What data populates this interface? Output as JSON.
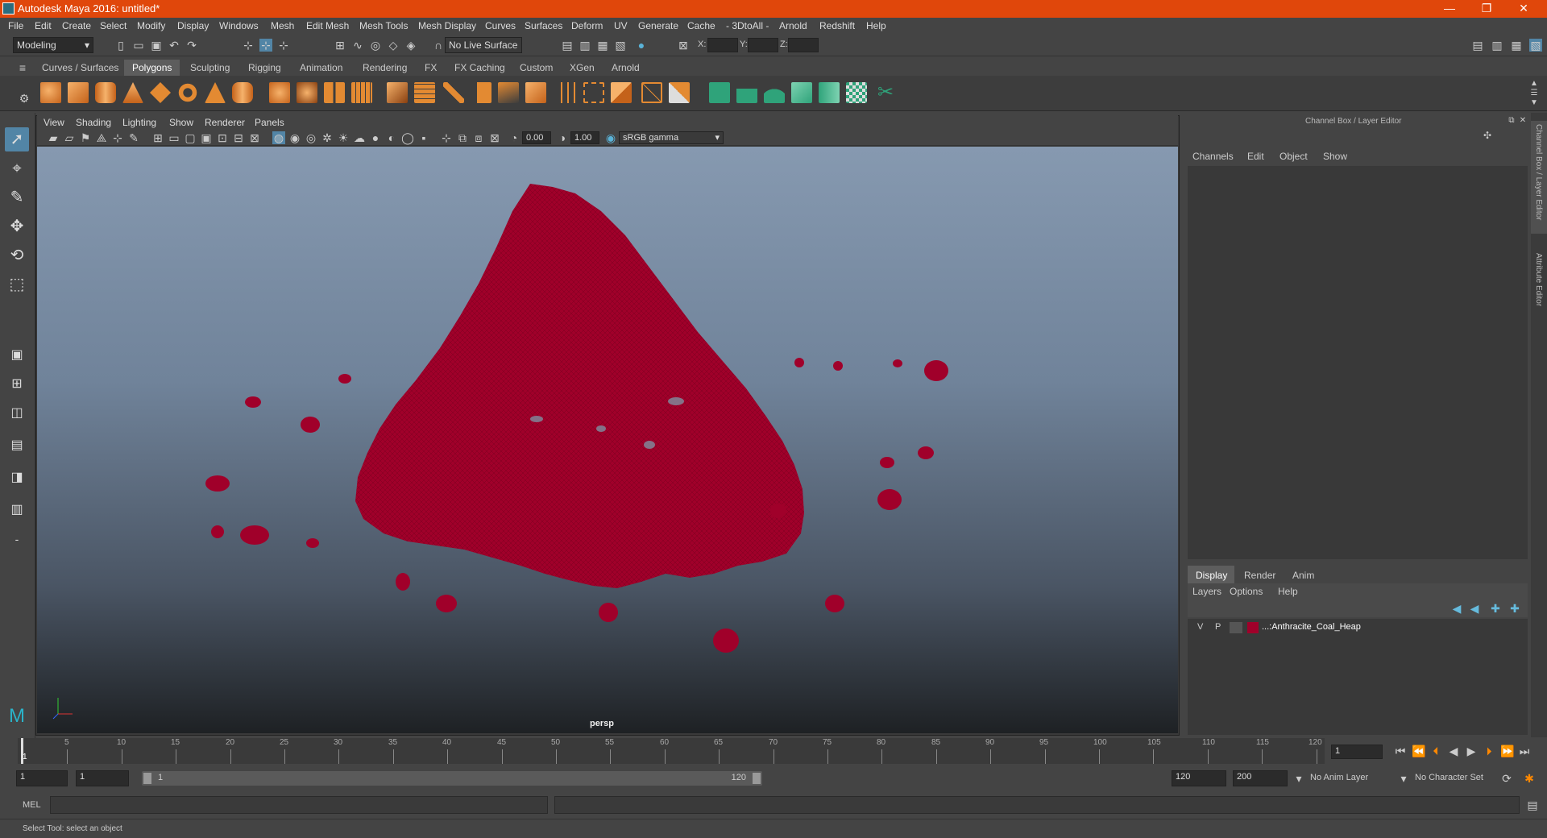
{
  "window": {
    "title": "Autodesk Maya 2016: untitled*",
    "minimize": "—",
    "restore": "❐",
    "close": "✕"
  },
  "menus": [
    "File",
    "Edit",
    "Create",
    "Select",
    "Modify",
    "Display",
    "Windows",
    "Mesh",
    "Edit Mesh",
    "Mesh Tools",
    "Mesh Display",
    "Curves",
    "Surfaces",
    "Deform",
    "UV",
    "Generate",
    "Cache",
    "- 3DtoAll -",
    "Arnold",
    "Redshift",
    "Help"
  ],
  "status": {
    "mode": "Modeling",
    "live_surface": "No Live Surface",
    "x_label": "X:",
    "y_label": "Y:",
    "z_label": "Z:"
  },
  "shelf": {
    "tabs": [
      "Curves / Surfaces",
      "Polygons",
      "Sculpting",
      "Rigging",
      "Animation",
      "Rendering",
      "FX",
      "FX Caching",
      "Custom",
      "XGen",
      "Arnold"
    ],
    "active_tab": "Polygons"
  },
  "viewport": {
    "menus": [
      "View",
      "Shading",
      "Lighting",
      "Show",
      "Renderer",
      "Panels"
    ],
    "exposure": "0.00",
    "gamma": "1.00",
    "color_space": "sRGB gamma",
    "camera_label": "persp",
    "mesh_color": "#a0002a"
  },
  "channel_box": {
    "header": "Channel Box / Layer Editor",
    "menus": [
      "Channels",
      "Edit",
      "Object",
      "Show"
    ]
  },
  "layer_editor": {
    "tabs": [
      "Display",
      "Render",
      "Anim"
    ],
    "active_tab": "Display",
    "menus": [
      "Layers",
      "Options",
      "Help"
    ],
    "layers": [
      {
        "v": "V",
        "p": "P",
        "color": "#a0002a",
        "name": "...:Anthracite_Coal_Heap"
      }
    ]
  },
  "side_tabs": [
    "Channel Box / Layer Editor",
    "Attribute Editor"
  ],
  "timeline": {
    "ticks": [
      "5",
      "10",
      "15",
      "20",
      "25",
      "30",
      "35",
      "40",
      "45",
      "50",
      "55",
      "60",
      "65",
      "70",
      "75",
      "80",
      "85",
      "90",
      "95",
      "100",
      "105",
      "110",
      "115",
      "120"
    ],
    "current_frame_marker": "1",
    "current_frame_field": "1"
  },
  "range": {
    "start": "1",
    "playback_start": "1",
    "slider_start": "1",
    "slider_end": "120",
    "playback_end": "120",
    "end": "200",
    "anim_layer": "No Anim Layer",
    "character_set": "No Character Set"
  },
  "command": {
    "label": "MEL"
  },
  "help": {
    "text": "Select Tool: select an object"
  }
}
